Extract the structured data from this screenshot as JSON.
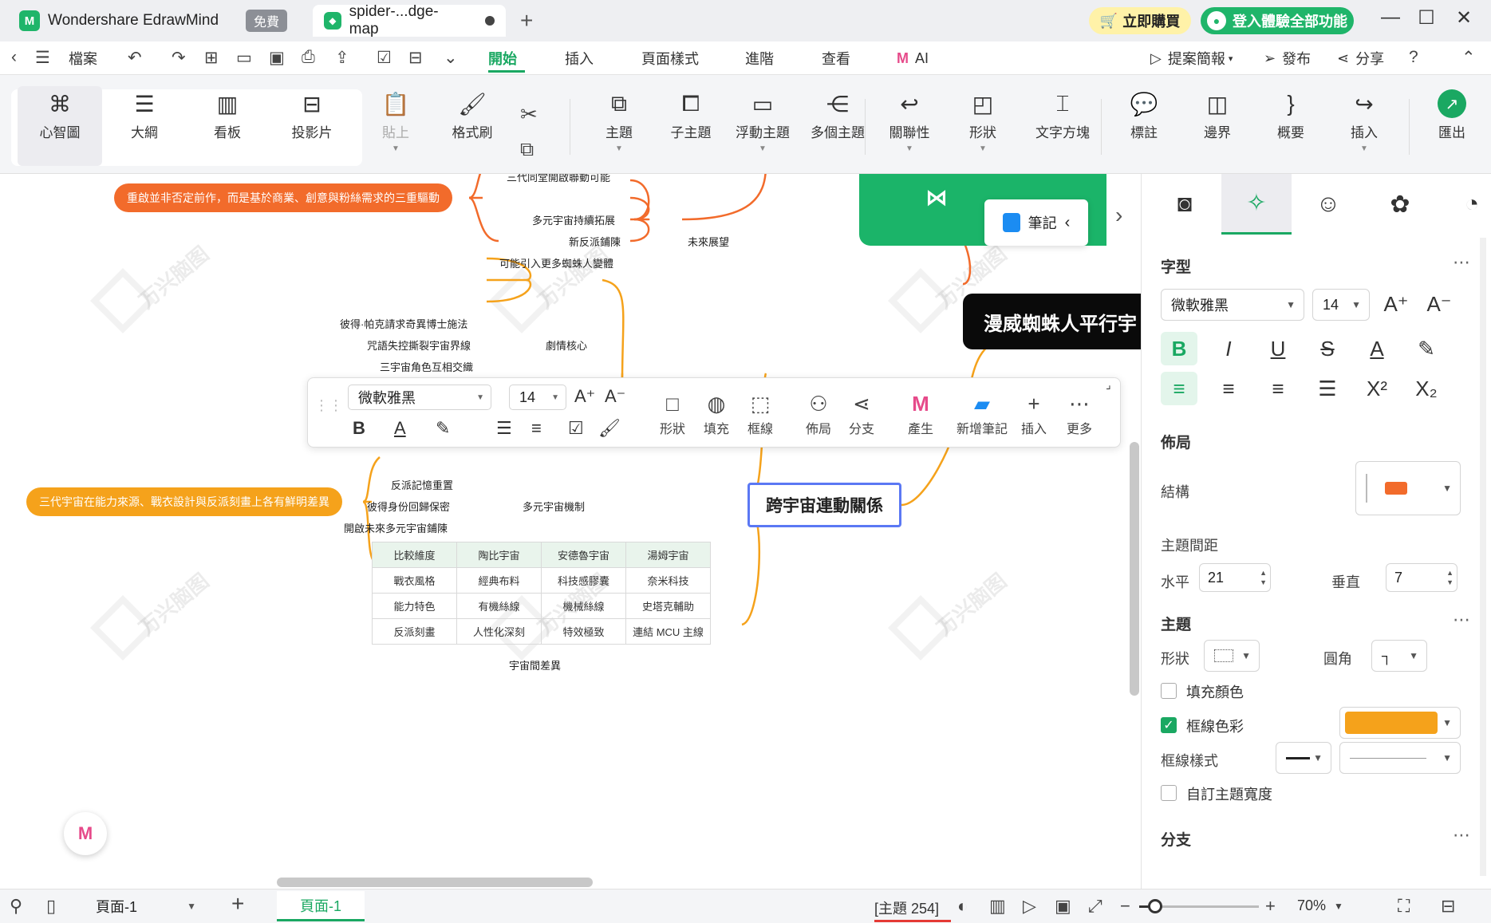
{
  "window": {
    "app_tab": "Wondershare EdrawMind",
    "free_badge": "免費",
    "doc_tab": "spider-...dge-map",
    "new_tab": "+",
    "buy_label": "立即購買",
    "login_label": "登入體驗全部功能",
    "minimize": "—",
    "maximize": "☐",
    "close": "✕"
  },
  "menubar": {
    "file": "檔案",
    "tabs": [
      "開始",
      "插入",
      "頁面樣式",
      "進階",
      "查看",
      "AI"
    ],
    "active_tab": "開始",
    "right": {
      "present": "提案簡報",
      "publish": "發布",
      "share": "分享"
    }
  },
  "ribbon": {
    "views": [
      "心智圖",
      "大綱",
      "看板",
      "投影片"
    ],
    "paste": "貼上",
    "format_painter": "格式刷",
    "tools": [
      "主題",
      "子主題",
      "浮動主題",
      "多個主題",
      "關聯性",
      "形狀",
      "文字方塊",
      "標註",
      "邊界",
      "概要",
      "插入"
    ],
    "export": "匯出"
  },
  "canvas": {
    "watermark": "万兴脑图",
    "center_topic": "跨宇宙連動關係",
    "root_topic": "漫威蜘蛛人平行宇",
    "note_button": "筆記",
    "pill_top": {
      "text": "重啟並非否定前作，而是基於商業、創意與粉絲需求的三重驅動",
      "color": "#f26b2b"
    },
    "pill_bottom": {
      "text": "三代宇宙在能力來源、戰衣設計與反派刻畫上各有鮮明差異",
      "color": "#f5a21b"
    },
    "future_group": {
      "label": "未來展望",
      "items": [
        "三代同堂開啟聯動可能",
        "多元宇宙持續拓展",
        "新反派鋪陳",
        "可能引入更多蜘蛛人變體"
      ]
    },
    "plot_group": {
      "label": "劇情核心",
      "items": [
        "彼得·帕克請求奇異博士施法",
        "咒語失控撕裂宇宙界線",
        "三宇宙角色互相交織"
      ]
    },
    "mechanism_group": {
      "label": "多元宇宙機制",
      "items": [
        "反派記憶重置",
        "彼得身份回歸保密",
        "開啟未來多元宇宙鋪陳"
      ]
    },
    "table_label": "宇宙間差異",
    "table": [
      [
        "比較維度",
        "陶比宇宙",
        "安德魯宇宙",
        "湯姆宇宙"
      ],
      [
        "戰衣風格",
        "經典布料",
        "科技感膠囊",
        "奈米科技"
      ],
      [
        "能力特色",
        "有機絲線",
        "機械絲線",
        "史塔克輔助"
      ],
      [
        "反派刻畫",
        "人性化深刻",
        "特效極致",
        "連結 MCU 主線"
      ]
    ],
    "branch_color_orange": "#f5a21b",
    "branch_color_red": "#f26b2b"
  },
  "floatbar": {
    "font": "微軟雅黑",
    "size": "14",
    "buttons": [
      "形狀",
      "填充",
      "框線",
      "佈局",
      "分支",
      "產生",
      "新增筆記",
      "插入",
      "更多"
    ]
  },
  "panel": {
    "font_section": "字型",
    "font": "微軟雅黑",
    "font_size": "14",
    "layout_section": "佈局",
    "structure": "結構",
    "spacing": "主題間距",
    "horizontal": "水平",
    "horizontal_value": "21",
    "vertical": "垂直",
    "vertical_value": "7",
    "topic_section": "主題",
    "shape": "形狀",
    "corner": "圓角",
    "fill_color": "填充顏色",
    "border_color": "框線色彩",
    "border_color_value": "#f5a21b",
    "border_style": "框線樣式",
    "custom_width": "自訂主題寬度",
    "branch_section": "分支"
  },
  "statusbar": {
    "page_select": "頁面-1",
    "page_tab": "頁面-1",
    "topic_count": "[主題 254]",
    "zoom": "70%",
    "zoom_level": 0.13
  }
}
